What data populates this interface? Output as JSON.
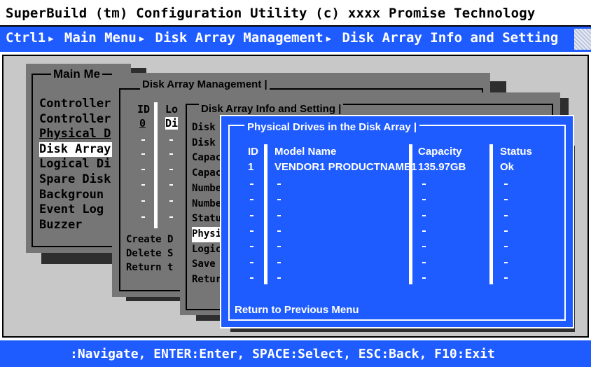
{
  "title": "SuperBuild (tm) Configuration Utility (c) xxxx Promise Technology",
  "breadcrumb": [
    "Ctrl1",
    "Main Menu",
    "Disk Array Management",
    "Disk Array Info and Setting"
  ],
  "status_bar": ":Navigate, ENTER:Enter, SPACE:Select, ESC:Back, F10:Exit",
  "main_menu": {
    "title": "Main Me",
    "items": [
      "Controller",
      "Controller",
      "Physical D",
      "Disk Array",
      "Logical Di",
      "Spare Disk",
      "Backgroun",
      "Event Log",
      "Buzzer"
    ],
    "selected_index": 3
  },
  "dam": {
    "title": "Disk Array Management |",
    "col_id": "ID",
    "col_lo": "Lo",
    "row1_id": "0",
    "row1_lo": "Di",
    "actions": [
      "Create D",
      "Delete S",
      "Return t"
    ]
  },
  "dais": {
    "title": "Disk Array Info and Setting |",
    "items": [
      "Disk",
      "Disk",
      "Capac",
      "Capac",
      "Numbe",
      "Numbe",
      "Statu",
      "Physi",
      "Logic",
      "Save",
      "Retur"
    ],
    "selected_index": 7
  },
  "pd": {
    "title": "Physical Drives in the Disk Array |",
    "headers": {
      "id": "ID",
      "model": "Model Name",
      "capacity": "Capacity",
      "status": "Status"
    },
    "rows": [
      {
        "id": "1",
        "model": "VENDOR1 PRODUCTNAME1",
        "capacity": "135.97GB",
        "status": "Ok"
      }
    ],
    "empty_rows": 7,
    "footer": "Return to Previous Menu"
  },
  "colors": {
    "accent": "#1f5cff",
    "panel_gray": "#767676",
    "desktop_gray": "#c8c8c8"
  }
}
